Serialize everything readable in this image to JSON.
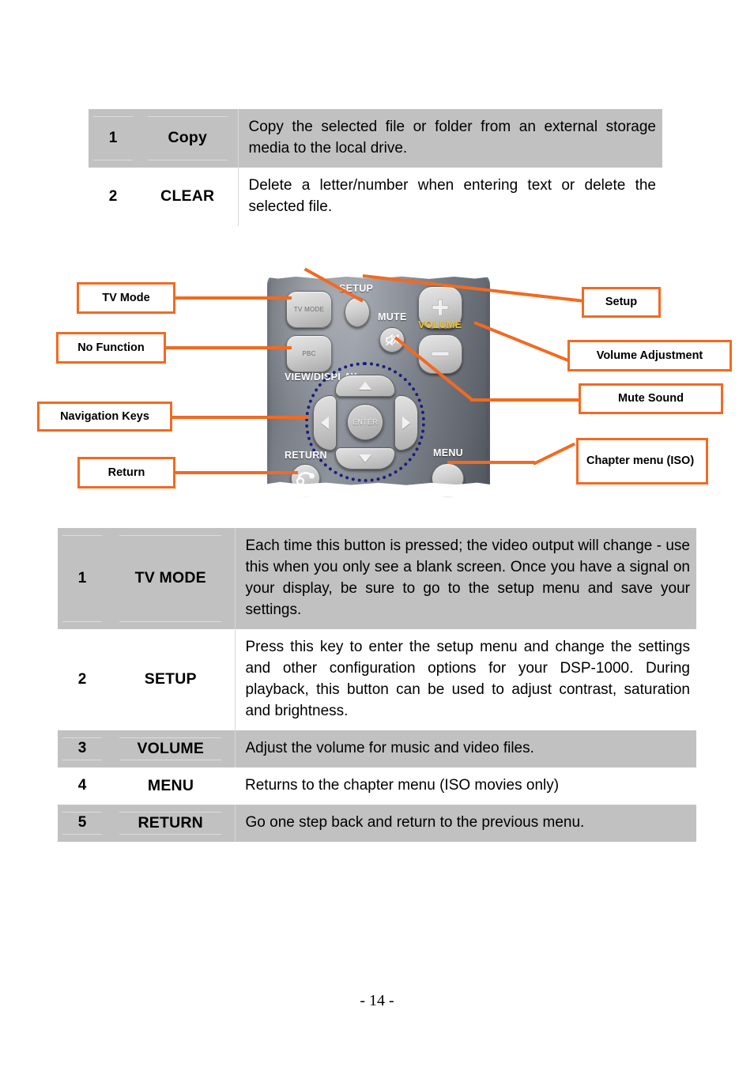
{
  "top_table": {
    "rows": [
      {
        "num": "1",
        "label": "Copy",
        "desc": "Copy the selected file or folder from an external storage media to the local drive.",
        "shaded": true
      },
      {
        "num": "2",
        "label": "CLEAR",
        "desc": "Delete a letter/number when entering text or delete the selected file.",
        "shaded": false
      }
    ]
  },
  "figure": {
    "callouts_left": [
      {
        "text": "TV Mode",
        "name": "callout-tv-mode"
      },
      {
        "text": "No Function",
        "name": "callout-no-function"
      },
      {
        "text": "Navigation Keys",
        "name": "callout-navigation-keys"
      },
      {
        "text": "Return",
        "name": "callout-return"
      }
    ],
    "callouts_right": [
      {
        "text": "Setup",
        "name": "callout-setup"
      },
      {
        "text": "Volume Adjustment",
        "name": "callout-volume-adjustment"
      },
      {
        "text": "Mute Sound",
        "name": "callout-mute-sound"
      },
      {
        "text": "Chapter menu (ISO)",
        "name": "callout-chapter-menu"
      }
    ],
    "remote": {
      "buttons": {
        "tv_mode": "TV MODE",
        "pbc": "PBC",
        "enter": "ENTER"
      },
      "silkscreen": {
        "setup": "SETUP",
        "mute": "MUTE",
        "volume": "VOLUME",
        "view_display": "VIEW/DISPLAY",
        "return": "RETURN",
        "menu": "MENU"
      }
    },
    "colors": {
      "callout_border": "#F26A21",
      "connector": "#F26A21",
      "nav_ring": "#1D1D7A",
      "volume_text": "#F2C31E",
      "table_shade": "#C1C1C1"
    }
  },
  "bottom_table": {
    "rows": [
      {
        "num": "1",
        "label": "TV MODE",
        "desc": "Each time this button is pressed; the video output will change - use this when you only see a blank screen. Once you have a signal on your display, be sure to go to the setup menu and save your settings.",
        "shaded": true
      },
      {
        "num": "2",
        "label": "SETUP",
        "desc": "Press this key to enter the setup menu and change the settings and other configuration options for your DSP-1000. During playback, this button can be used to adjust contrast, saturation and brightness.",
        "shaded": false
      },
      {
        "num": "3",
        "label": "VOLUME",
        "desc": "Adjust the volume for music and video files.",
        "shaded": true
      },
      {
        "num": "4",
        "label": "MENU",
        "desc": "Returns to the chapter menu (ISO movies only)",
        "shaded": false
      },
      {
        "num": "5",
        "label": "RETURN",
        "desc": "Go one step back and return to the previous menu.",
        "shaded": true
      }
    ]
  },
  "footer": {
    "page_number": "- 14 -"
  }
}
